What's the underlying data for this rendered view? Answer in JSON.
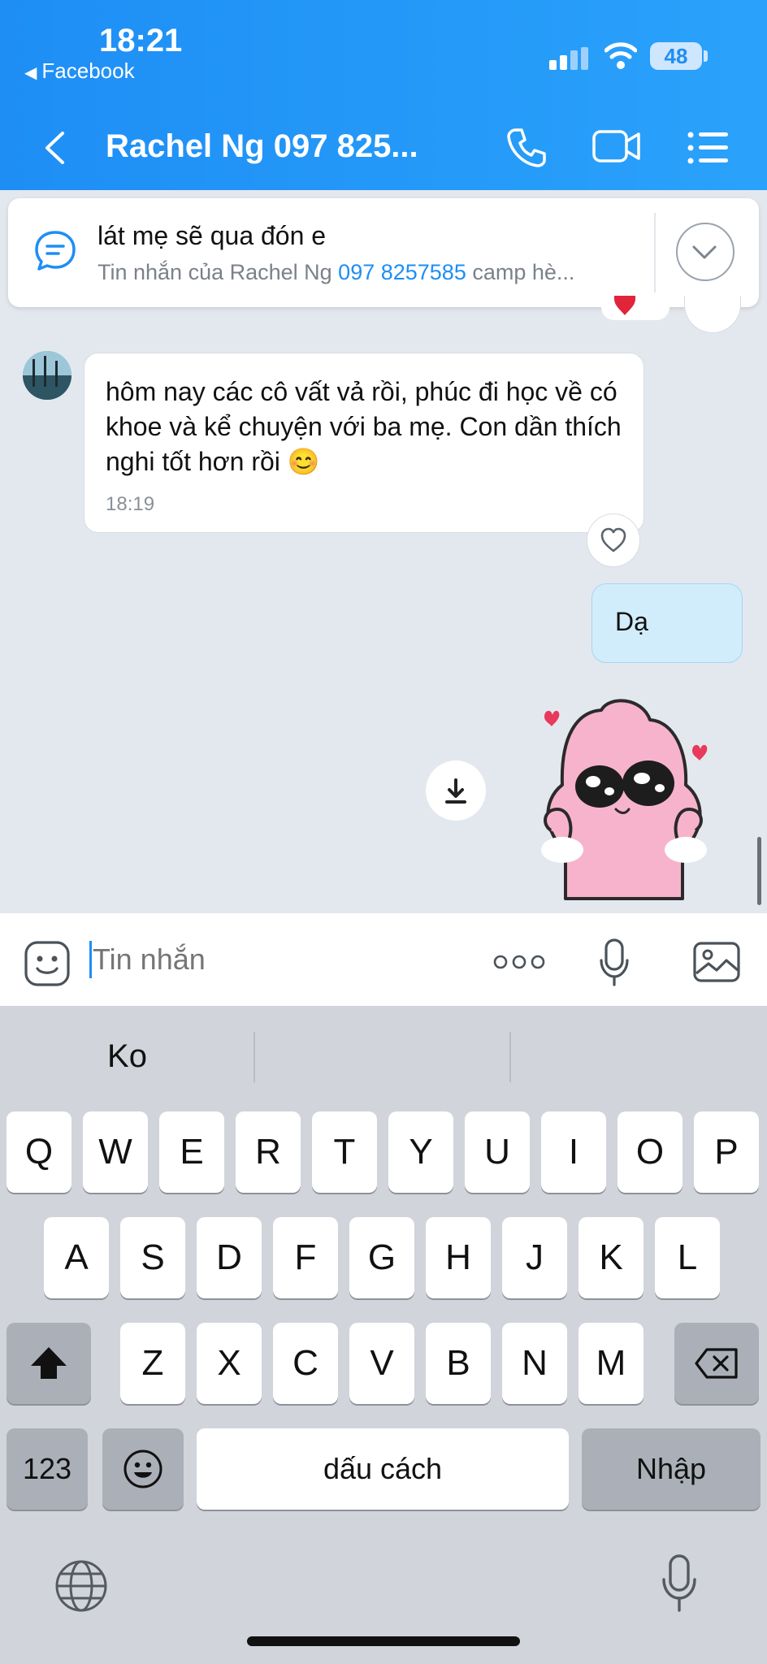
{
  "status_bar": {
    "time": "18:21",
    "back_app": "Facebook",
    "battery": "48"
  },
  "header": {
    "title": "Rachel Ng 097 825..."
  },
  "pinned": {
    "text": "lát mẹ sẽ qua đón e",
    "sub_prefix": "Tin nhắn của Rachel Ng ",
    "sub_link": "097 8257585",
    "sub_suffix": " camp hè..."
  },
  "messages": [
    {
      "from": "Rachel Ng",
      "text": "hôm nay các cô vất vả rồi, phúc đi học về có khoe và kể chuyện với ba mẹ. Con dần thích nghi tốt hơn rồi 😊",
      "time": "18:19"
    },
    {
      "from": "me",
      "text": "Dạ"
    }
  ],
  "input": {
    "placeholder": "Tin nhắn"
  },
  "keyboard": {
    "suggestions": [
      "Ko",
      "",
      ""
    ],
    "row1": [
      "Q",
      "W",
      "E",
      "R",
      "T",
      "Y",
      "U",
      "I",
      "O",
      "P"
    ],
    "row2": [
      "A",
      "S",
      "D",
      "F",
      "G",
      "H",
      "J",
      "K",
      "L"
    ],
    "row3": [
      "Z",
      "X",
      "C",
      "V",
      "B",
      "N",
      "M"
    ],
    "numbers_key": "123",
    "space_key": "dấu cách",
    "return_key": "Nhập"
  },
  "colors": {
    "header_start": "#1e8ef5",
    "header_end": "#2aa2fb",
    "outgoing_bubble": "#d1edfb",
    "link": "#1e8ef5"
  }
}
